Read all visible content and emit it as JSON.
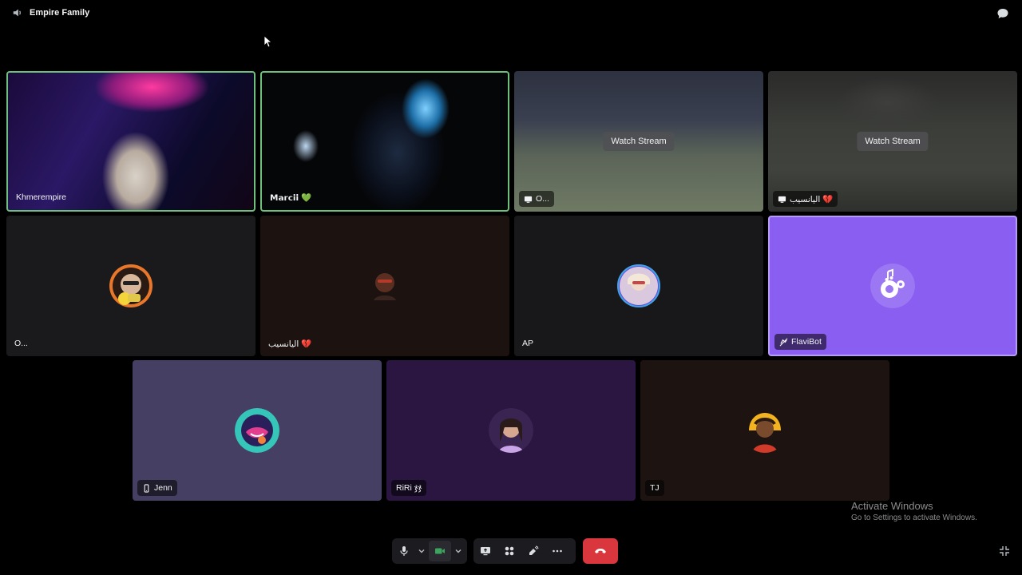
{
  "header": {
    "channel_name": "Empire Family"
  },
  "tiles": [
    {
      "name": "Khmerempire"
    },
    {
      "name": "𝗠𝗮𝗿𝗰𝗶𝗶 💚"
    },
    {
      "name": "O...",
      "action": "Watch Stream"
    },
    {
      "name": "اليانسيب 💔",
      "action": "Watch Stream"
    },
    {
      "name": "O..."
    },
    {
      "name": "اليانسيب 💔"
    },
    {
      "name": "AP"
    },
    {
      "name": "FlaviBot"
    },
    {
      "name": "Jenn"
    },
    {
      "name": "RiRi ჯჯ"
    },
    {
      "name": "TJ"
    }
  ],
  "watermark": {
    "title": "Activate Windows",
    "subtitle": "Go to Settings to activate Windows."
  },
  "colors": {
    "speaking_border": "#6fbf7d",
    "hangup": "#d9363e",
    "bot_tile": "#8a5ef0"
  }
}
